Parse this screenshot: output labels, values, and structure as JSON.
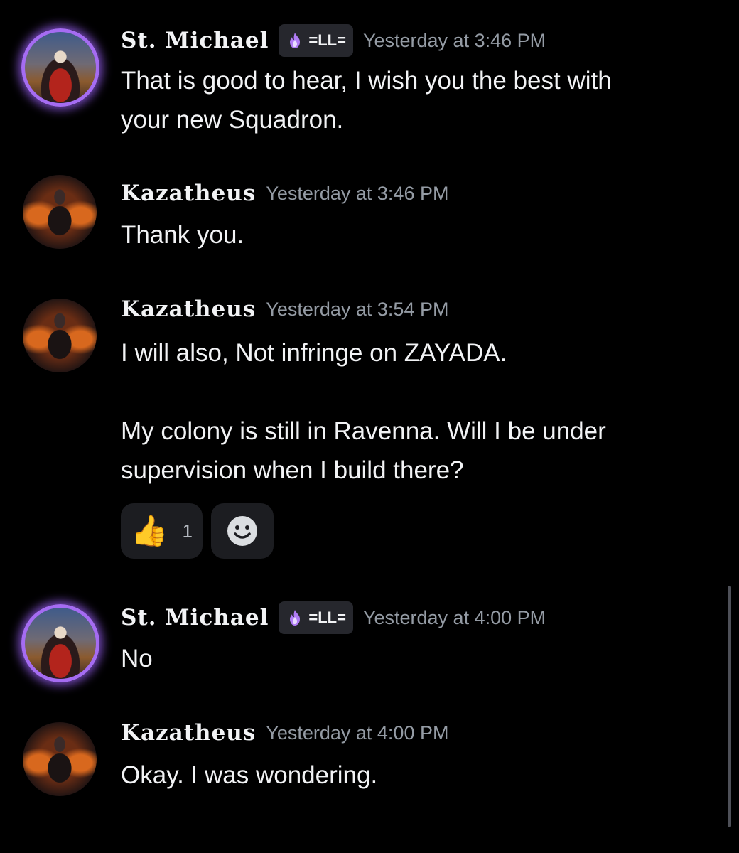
{
  "messages": [
    {
      "author": "St. Michael",
      "tag": "=LL=",
      "timestamp": "Yesterday at 3:46 PM",
      "lines": [
        "That is good to hear, I wish you the best with",
        "your new Squadron."
      ]
    },
    {
      "author": "Kazatheus",
      "timestamp": "Yesterday at 3:46 PM",
      "lines": [
        "Thank you."
      ]
    },
    {
      "author": "Kazatheus",
      "timestamp": "Yesterday at 3:54 PM",
      "paragraph1": "I will also, Not infringe on ZAYADA.",
      "paragraph2_line1": "My colony is still in Ravenna. Will I be under",
      "paragraph2_line2": "supervision when I build there?",
      "reactions": [
        {
          "emoji": "👍",
          "icon": "thumbs-up-icon",
          "count": "1"
        }
      ],
      "add_reaction_icon": "smiley-icon"
    },
    {
      "author": "St. Michael",
      "tag": "=LL=",
      "timestamp": "Yesterday at 4:00 PM",
      "lines": [
        "No"
      ]
    },
    {
      "author": "Kazatheus",
      "timestamp": "Yesterday at 4:00 PM",
      "lines": [
        "Okay. I was wondering."
      ]
    }
  ],
  "colors": {
    "background": "#000000",
    "text": "#f2f3f5",
    "timestamp": "#949ba4",
    "tag_bg": "#26272d",
    "avatar_ring": "#a56cf2",
    "reaction_bg": "#1c1d21"
  }
}
